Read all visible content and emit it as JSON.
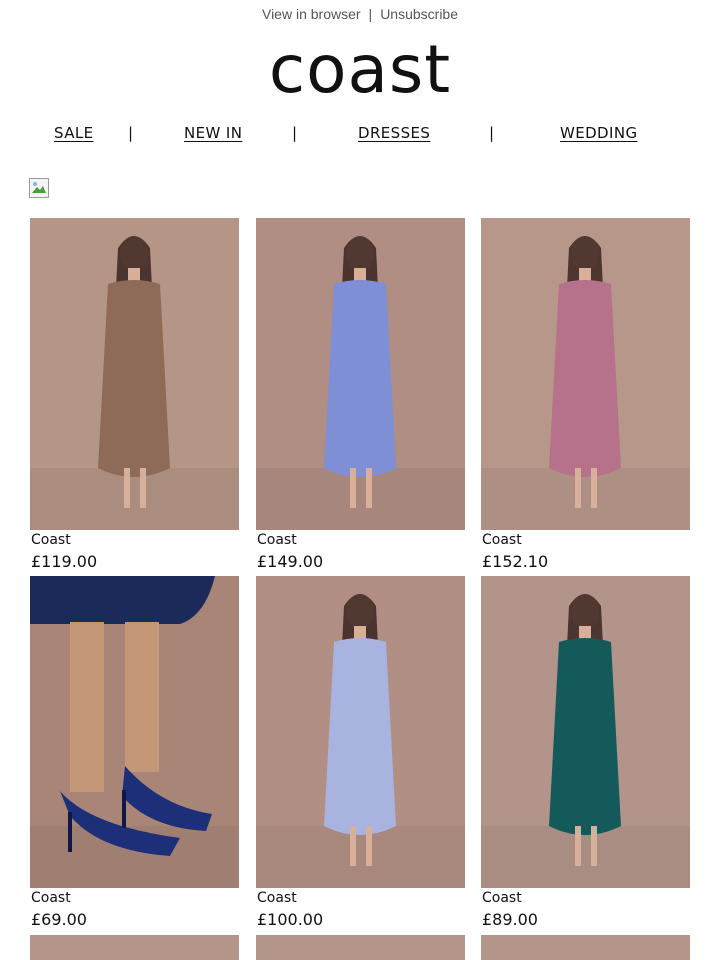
{
  "header": {
    "view_in_browser": "View in browser",
    "separator": "|",
    "unsubscribe": "Unsubscribe"
  },
  "logo": {
    "text": "coast"
  },
  "nav": {
    "items": [
      {
        "label": "SALE"
      },
      {
        "label": "NEW IN"
      },
      {
        "label": "DRESSES"
      },
      {
        "label": "WEDDING"
      }
    ],
    "divider": "|"
  },
  "products": [
    {
      "brand": "Coast",
      "price": "£119.00",
      "image": "mocha-satin-midi-dress",
      "bg": "#b49586",
      "garment": "#8d6b58"
    },
    {
      "brand": "Coast",
      "price": "£149.00",
      "image": "blue-floral-cape-maxi-dress",
      "bg": "#b08e84",
      "garment": "#7f8fd6"
    },
    {
      "brand": "Coast",
      "price": "£152.10",
      "image": "pink-embroidered-midi-dress",
      "bg": "#b8978b",
      "garment": "#b5728a"
    },
    {
      "brand": "Coast",
      "price": "£69.00",
      "image": "navy-bow-slingback-heels",
      "bg": "#a98578",
      "garment": "#1d2f78"
    },
    {
      "brand": "Coast",
      "price": "£100.00",
      "image": "lilac-floral-tiered-maxi-dress",
      "bg": "#b18f84",
      "garment": "#a9b3e0"
    },
    {
      "brand": "Coast",
      "price": "£89.00",
      "image": "teal-lace-bardot-dress",
      "bg": "#b3948a",
      "garment": "#145a5a"
    }
  ]
}
